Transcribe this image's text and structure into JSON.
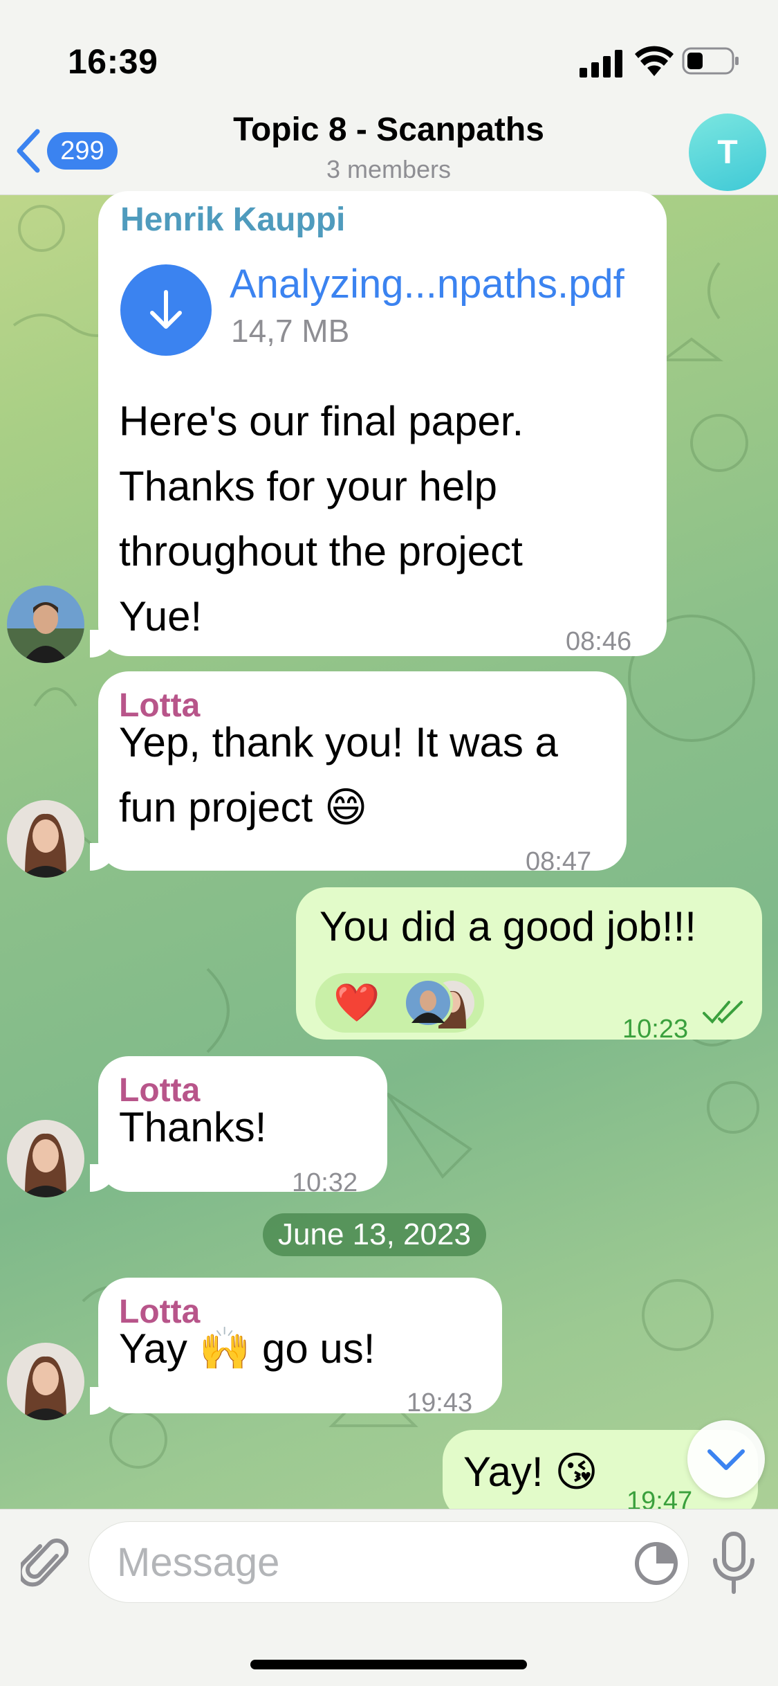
{
  "status_bar": {
    "time": "16:39"
  },
  "header": {
    "back_count": "299",
    "title": "Topic 8 - Scanpaths",
    "subtitle": "3 members",
    "avatar_letter": "T"
  },
  "messages": [
    {
      "sender": "Henrik Kauppi",
      "file_name": "Analyzing...npaths.pdf",
      "file_size": "14,7 MB",
      "lines": [
        "Here's our final paper.",
        "Thanks for your help",
        "throughout the project",
        "Yue!"
      ],
      "time": "08:46"
    },
    {
      "sender": "Lotta",
      "lines": [
        "Yep, thank you! It was a",
        "fun project 😄"
      ],
      "time": "08:47"
    },
    {
      "text": "You did a good job!!!",
      "reaction": "❤️",
      "time": "10:23"
    },
    {
      "sender": "Lotta",
      "text": "Thanks!",
      "time": "10:32"
    },
    {
      "sender": "Lotta",
      "text": "Yay 🙌 go us!",
      "time": "19:43"
    },
    {
      "text": "Yay! 😘",
      "time": "19:47"
    }
  ],
  "date_separator": "June 13, 2023",
  "input": {
    "placeholder": "Message"
  },
  "colors": {
    "accent": "#3b83f0",
    "outgoing_bubble": "#e2fbc9",
    "lotta_name": "#b8558a",
    "henrik_name": "#4f9bbd",
    "read_check": "#3aa03d"
  }
}
